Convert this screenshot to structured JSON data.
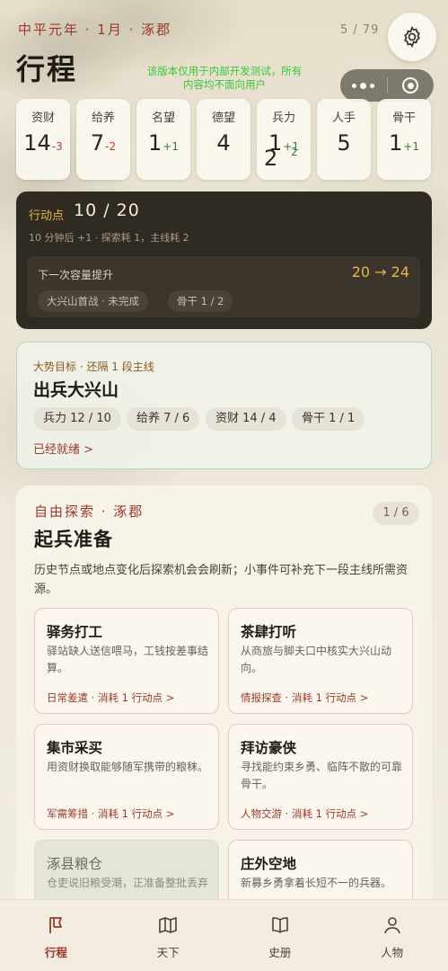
{
  "header": {
    "era": "中平元年 · 1月 · 涿郡",
    "page_count": "5 / 79",
    "title": "行程",
    "notice": "该版本仅用于内部开发测试，所有内容均不面向用户"
  },
  "stats": [
    {
      "label": "资财",
      "value": "14",
      "delta": "-3",
      "delta_type": "neg"
    },
    {
      "label": "给养",
      "value": "7",
      "delta": "-2",
      "delta_type": "neg"
    },
    {
      "label": "名望",
      "value": "1",
      "delta": "+1",
      "delta_type": "pos"
    },
    {
      "label": "德望",
      "value": "4",
      "delta": "",
      "delta_type": ""
    },
    {
      "label": "兵力",
      "value": "1",
      "delta": "+1",
      "delta_type": "pos",
      "value2": "2",
      "delta2": "2"
    },
    {
      "label": "人手",
      "value": "5",
      "delta": "",
      "delta_type": ""
    },
    {
      "label": "骨干",
      "value": "1",
      "delta": "+1",
      "delta_type": "pos"
    }
  ],
  "action": {
    "label": "行动点",
    "value": "10 / 20",
    "sub": "10 分钟后 +1 · 探索耗 1，主线耗 2",
    "next_label": "下一次容量提升",
    "next_range": "20 → 24",
    "chips": [
      "大兴山首战 · 未完成",
      "骨干 1 / 2"
    ]
  },
  "goal": {
    "label": "大势目标 · 还隔 1 段主线",
    "title": "出兵大兴山",
    "chips": [
      "兵力 12 / 10",
      "给养 7 / 6",
      "资财 14 / 4",
      "骨干 1 / 1"
    ],
    "ready": "已经就绪 >"
  },
  "explore": {
    "label": "自由探索 · 涿郡",
    "count": "1 / 6",
    "title": "起兵准备",
    "desc": "历史节点或地点变化后探索机会会刷新；小事件可补充下一段主线所需资源。",
    "tasks": [
      {
        "title": "驿务打工",
        "desc": "驿站缺人送信喂马，工钱按差事结算。",
        "action": "日常差遣 · 消耗 1 行动点 >"
      },
      {
        "title": "茶肆打听",
        "desc": "从商旅与脚夫口中核实大兴山动向。",
        "action": "情报探查 · 消耗 1 行动点 >"
      },
      {
        "title": "集市采买",
        "desc": "用资财换取能够随军携带的粮秣。",
        "action": "军需筹措 · 消耗 1 行动点 >"
      },
      {
        "title": "拜访豪侠",
        "desc": "寻找能约束乡勇、临阵不散的可靠骨干。",
        "action": "人物交游 · 消耗 1 行动点 >"
      },
      {
        "title": "涿县粮仓",
        "desc": "仓吏说旧粮受潮，正准备整批丢弃",
        "action": ""
      },
      {
        "title": "庄外空地",
        "desc": "新募乡勇拿着长短不一的兵器。",
        "action": ""
      }
    ]
  },
  "tabs": [
    {
      "label": "行程",
      "icon": "flag-icon",
      "active": true
    },
    {
      "label": "天下",
      "icon": "map-icon",
      "active": false
    },
    {
      "label": "史册",
      "icon": "book-icon",
      "active": false
    },
    {
      "label": "人物",
      "icon": "person-icon",
      "active": false
    }
  ],
  "colors": {
    "accent": "#9b3a2c",
    "gold": "#e6b84a",
    "dark_card": "#2f2a22",
    "positive": "#3a7a3a",
    "negative": "#c0392b"
  }
}
